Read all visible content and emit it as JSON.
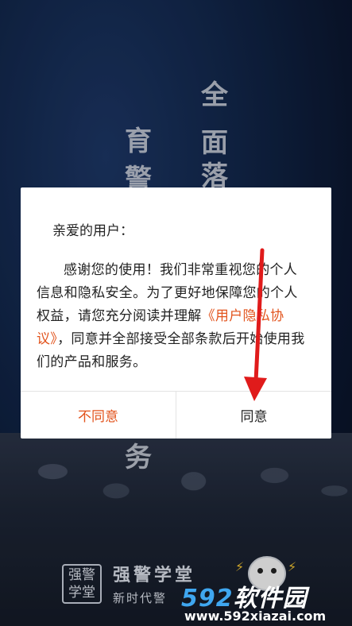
{
  "background": {
    "slogan_col1": [
      "全",
      "面",
      "落"
    ],
    "slogan_col2": [
      "育",
      "警"
    ],
    "slogan_bottom": "务",
    "brand_logo_text": "强警学堂",
    "brand_name": "强警学堂",
    "brand_subtitle": "新时代警"
  },
  "dialog": {
    "greeting": "亲爱的用户：",
    "body_before_link": "感谢您的使用！我们非常重视您的个人信息和隐私安全。为了更好地保障您的个人权益，请您充分阅读并理解",
    "policy_link": "《用户隐私协议》",
    "body_after_link": "，同意并全部接受全部条款后开始使用我们的产品和服务。",
    "decline_label": "不同意",
    "agree_label": "同意"
  },
  "watermark": {
    "brand_number": "592",
    "brand_text": "软件园",
    "url": "www.592xiazai.com"
  },
  "colors": {
    "accent": "#e2531c",
    "arrow": "#e01b1b",
    "watermark_blue": "#3fa7f0"
  }
}
